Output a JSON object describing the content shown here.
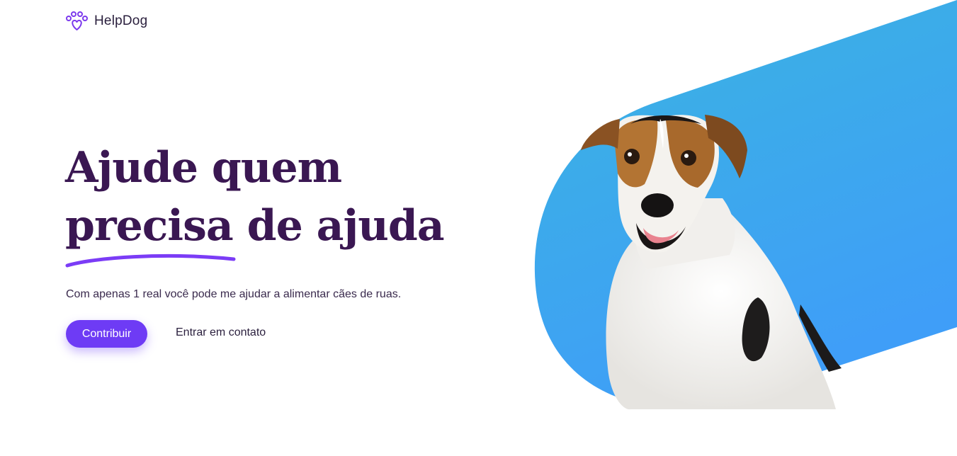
{
  "header": {
    "brand": "HelpDog",
    "logo_icon": "paw-heart-icon"
  },
  "hero": {
    "title_line1": "Ajude quem",
    "title_line2": "precisa de ajuda",
    "subtitle": "Com apenas 1 real você pode me ajudar a alimentar cães de ruas.",
    "primary_button": "Contribuir",
    "secondary_link": "Entrar em contato",
    "image": "dog-photo"
  },
  "colors": {
    "accent": "#6e3bf5",
    "title": "#3a1752",
    "gradient_top": "#3ab4e0",
    "gradient_bottom": "#3f9ef8"
  }
}
